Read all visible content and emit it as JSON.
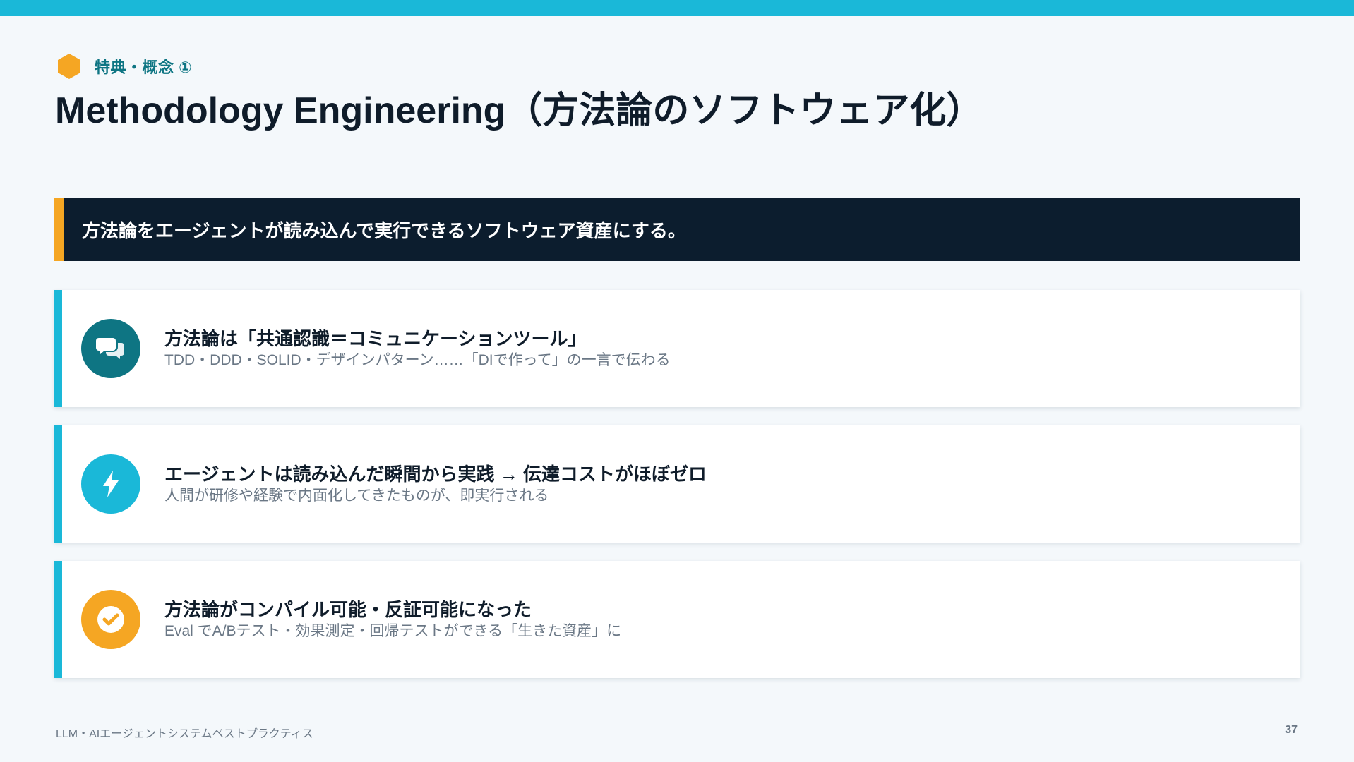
{
  "colors": {
    "top_bar": "#1ab8d8",
    "accent_orange": "#f5a623",
    "accent_cyan": "#1ab8d8",
    "teal": "#0e7583",
    "banner_bg": "#0c1d2e"
  },
  "header": {
    "eyebrow": "特典・概念 ①",
    "title": "Methodology Engineering（方法論のソフトウェア化）"
  },
  "banner": {
    "text": "方法論をエージェントが読み込んで実行できるソフトウェア資産にする。"
  },
  "cards": [
    {
      "icon": "chat-bubbles-icon",
      "icon_color": "#0e7583",
      "title": "方法論は「共通認識＝コミュニケーションツール」",
      "subtitle": "TDD・DDD・SOLID・デザインパターン……「DIで作って」の一言で伝わる"
    },
    {
      "icon": "lightning-bolt-icon",
      "icon_color": "#1ab8d8",
      "title": "エージェントは読み込んだ瞬間から実践 → 伝達コストがほぼゼロ",
      "subtitle": "人間が研修や経験で内面化してきたものが、即実行される"
    },
    {
      "icon": "check-circle-icon",
      "icon_color": "#f5a623",
      "title": "方法論がコンパイル可能・反証可能になった",
      "subtitle": "Eval でA/Bテスト・効果測定・回帰テストができる「生きた資産」に"
    }
  ],
  "footer": {
    "left": "LLM・AIエージェントシステムベストプラクティス",
    "page_number": "37"
  }
}
